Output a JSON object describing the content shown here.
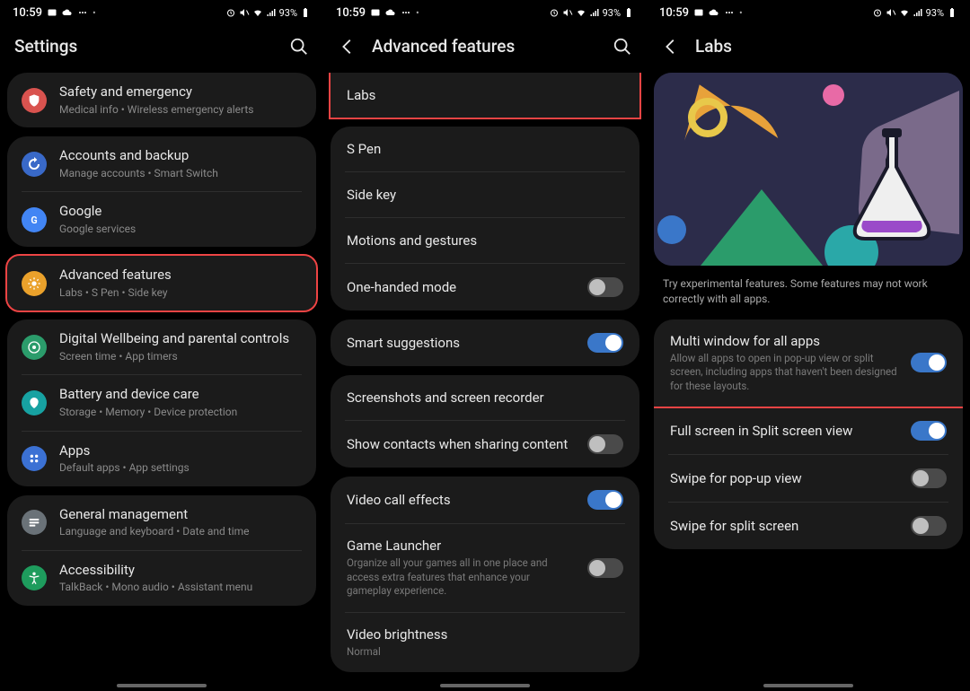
{
  "status": {
    "time": "10:59",
    "battery": "93%"
  },
  "screen1": {
    "title": "Settings",
    "groups": [
      {
        "items": [
          {
            "icon": "safety",
            "bg": "bg-red",
            "title": "Safety and emergency",
            "sub": "Medical info  •  Wireless emergency alerts"
          }
        ],
        "hl": false
      },
      {
        "items": [
          {
            "icon": "backup",
            "bg": "bg-blue",
            "title": "Accounts and backup",
            "sub": "Manage accounts  •  Smart Switch"
          },
          {
            "icon": "google",
            "bg": "bg-gblue",
            "title": "Google",
            "sub": "Google services"
          }
        ],
        "hl": false
      },
      {
        "items": [
          {
            "icon": "adv",
            "bg": "bg-orange",
            "title": "Advanced features",
            "sub": "Labs  •  S Pen  •  Side key"
          }
        ],
        "hl": true
      },
      {
        "items": [
          {
            "icon": "wellbeing",
            "bg": "bg-green",
            "title": "Digital Wellbeing and parental controls",
            "sub": "Screen time  •  App timers"
          },
          {
            "icon": "battery",
            "bg": "bg-teal",
            "title": "Battery and device care",
            "sub": "Storage  •  Memory  •  Device protection"
          },
          {
            "icon": "apps",
            "bg": "bg-lblue",
            "title": "Apps",
            "sub": "Default apps  •  App settings"
          }
        ],
        "hl": false
      },
      {
        "items": [
          {
            "icon": "general",
            "bg": "bg-gray",
            "title": "General management",
            "sub": "Language and keyboard  •  Date and time"
          },
          {
            "icon": "access",
            "bg": "bg-tgreen",
            "title": "Accessibility",
            "sub": "TalkBack  •  Mono audio  •  Assistant menu"
          }
        ],
        "hl": false
      }
    ]
  },
  "screen2": {
    "title": "Advanced features",
    "groups": [
      {
        "rows": [
          {
            "title": "Labs"
          }
        ],
        "hl": true
      },
      {
        "rows": [
          {
            "title": "S Pen"
          },
          {
            "title": "Side key"
          },
          {
            "title": "Motions and gestures"
          },
          {
            "title": "One-handed mode",
            "toggle": "off"
          }
        ]
      },
      {
        "rows": [
          {
            "title": "Smart suggestions",
            "toggle": "on"
          }
        ]
      },
      {
        "rows": [
          {
            "title": "Screenshots and screen recorder"
          },
          {
            "title": "Show contacts when sharing content",
            "toggle": "off"
          }
        ]
      },
      {
        "rows": [
          {
            "title": "Video call effects",
            "toggle": "on"
          },
          {
            "title": "Game Launcher",
            "sub": "Organize all your games all in one place and access extra features that enhance your gameplay experience.",
            "toggle": "off"
          },
          {
            "title": "Video brightness",
            "sub": "Normal"
          }
        ]
      }
    ]
  },
  "screen3": {
    "title": "Labs",
    "caption": "Try experimental features. Some features may not work correctly with all apps.",
    "rows": [
      {
        "title": "Multi window for all apps",
        "sub": "Allow all apps to open in pop-up view or split screen, including apps that haven't been designed for these layouts.",
        "toggle": "on",
        "hl": true
      },
      {
        "title": "Full screen in Split screen view",
        "toggle": "on"
      },
      {
        "title": "Swipe for pop-up view",
        "toggle": "off"
      },
      {
        "title": "Swipe for split screen",
        "toggle": "off"
      }
    ]
  }
}
